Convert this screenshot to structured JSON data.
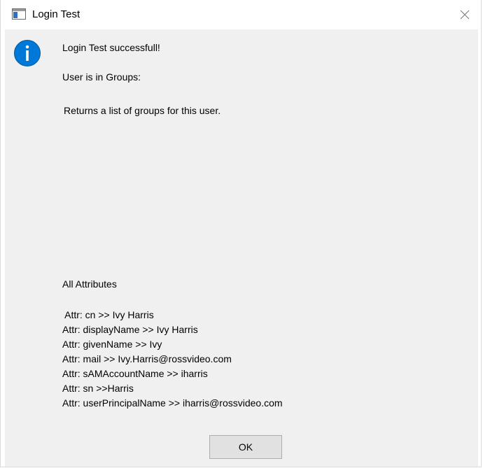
{
  "window": {
    "title": "Login Test",
    "app_icon": "window-app-icon",
    "close_icon": "close-icon"
  },
  "dialog": {
    "icon": "info-icon",
    "success_message": "Login Test successfull!",
    "groups_label": "User is in Groups:",
    "groups_list": "Returns a list of groups for this user.",
    "attributes_heading": "All Attributes",
    "attributes": [
      " Attr: cn >> Ivy Harris",
      "Attr: displayName >> Ivy Harris",
      "Attr: givenName >> Ivy",
      "Attr: mail >> Ivy.Harris@rossvideo.com",
      "Attr: sAMAccountName >> iharris",
      "Attr: sn >>Harris",
      "Attr: userPrincipalName >> iharris@rossvideo.com"
    ],
    "ok_label": "OK"
  },
  "colors": {
    "client_bg": "#f0f0f0",
    "info_blue": "#0078d7",
    "button_bg": "#e1e1e1",
    "button_border": "#adadad"
  }
}
